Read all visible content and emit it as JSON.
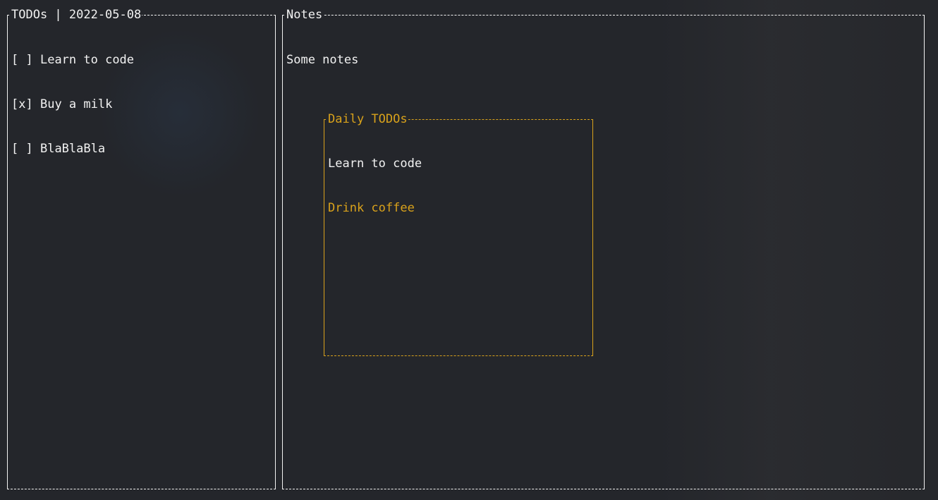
{
  "todos_panel": {
    "title": "TODOs | 2022-05-08",
    "items": [
      {
        "checkbox": "[ ]",
        "label": "Learn to code"
      },
      {
        "checkbox": "[x]",
        "label": "Buy a milk"
      },
      {
        "checkbox": "[ ]",
        "label": "BlaBlaBla"
      }
    ]
  },
  "notes_panel": {
    "title": "Notes",
    "text": "Some notes"
  },
  "daily_popup": {
    "title": "Daily TODOs",
    "items": [
      {
        "label": "Learn to code",
        "selected": true
      },
      {
        "label": "Drink coffee",
        "selected": false
      }
    ]
  },
  "colors": {
    "background": "#24262b",
    "foreground": "#f2f2f2",
    "accent": "#d9a21b"
  }
}
